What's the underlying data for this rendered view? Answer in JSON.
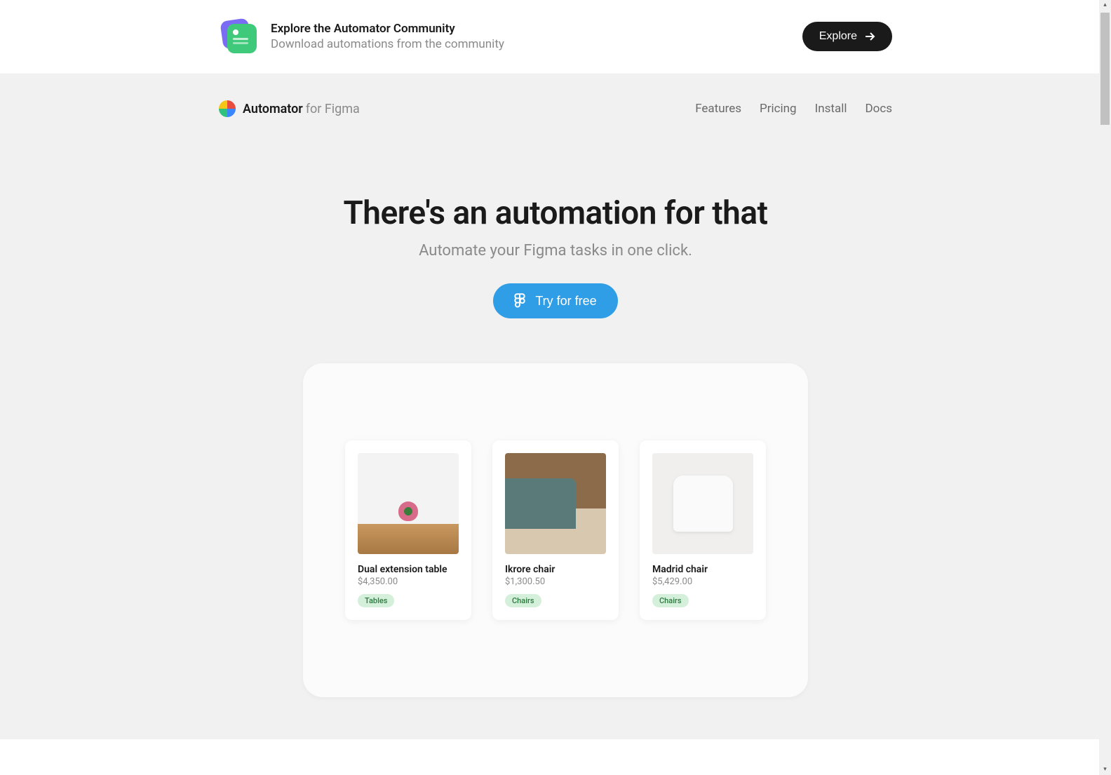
{
  "banner": {
    "title": "Explore the Automator Community",
    "subtitle": "Download automations from the community",
    "cta": "Explore"
  },
  "brand": {
    "name": "Automator",
    "suffix": "for Figma"
  },
  "nav": {
    "items": [
      "Features",
      "Pricing",
      "Install",
      "Docs"
    ]
  },
  "hero": {
    "headline": "There's an automation for that",
    "subhead": "Automate your Figma tasks in one click.",
    "cta": "Try for free"
  },
  "demo": {
    "cards": [
      {
        "title": "Dual extension table",
        "price": "$4,350.00",
        "tag": "Tables"
      },
      {
        "title": "Ikrore chair",
        "price": "$1,300.50",
        "tag": "Chairs"
      },
      {
        "title": "Madrid chair",
        "price": "$5,429.00",
        "tag": "Chairs"
      }
    ]
  }
}
